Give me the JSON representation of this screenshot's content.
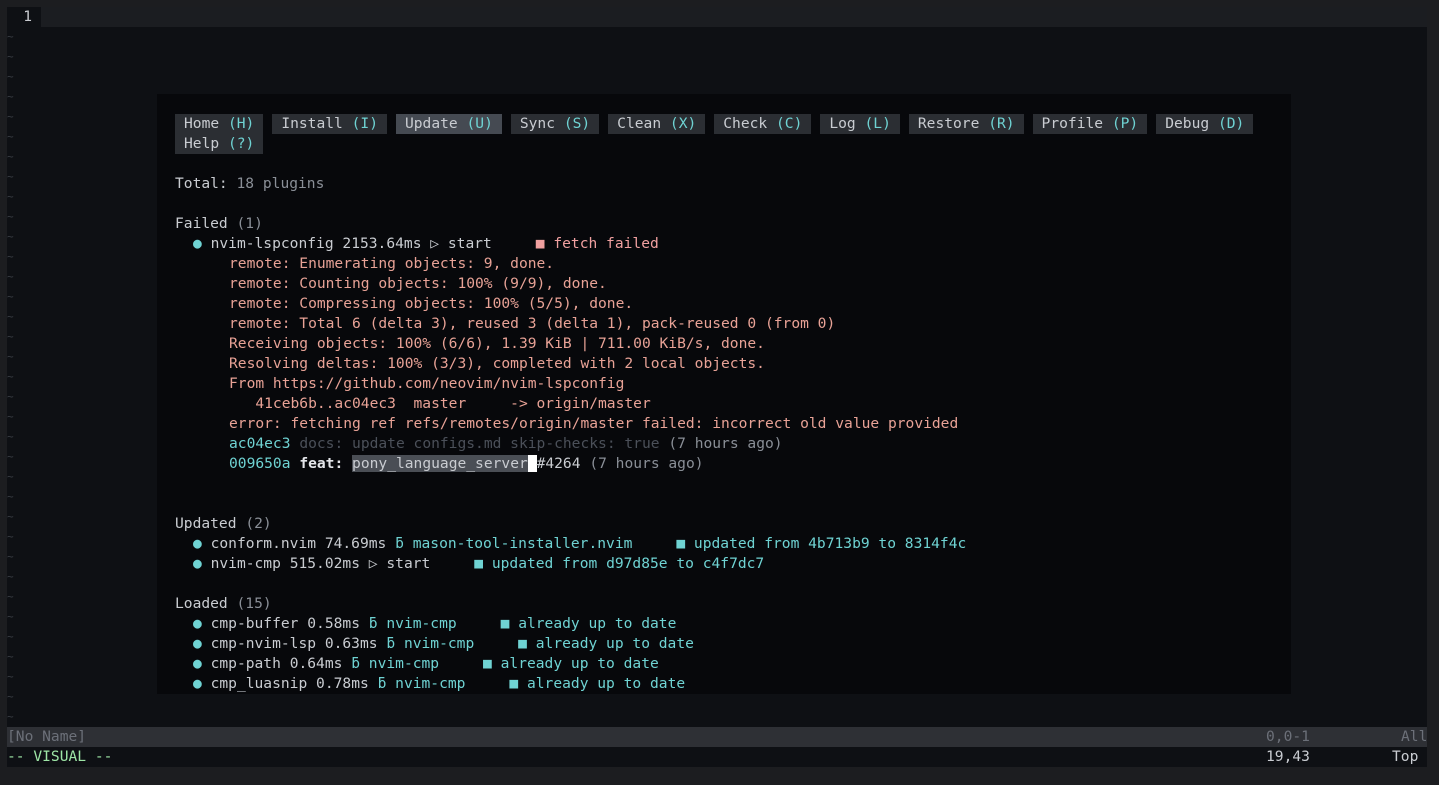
{
  "editor": {
    "line_number": "1",
    "tilde": "~"
  },
  "menu": [
    {
      "label": "Home",
      "key": "(H)"
    },
    {
      "label": "Install",
      "key": "(I)"
    },
    {
      "label": "Update",
      "key": "(U)",
      "active": true
    },
    {
      "label": "Sync",
      "key": "(S)"
    },
    {
      "label": "Clean",
      "key": "(X)"
    },
    {
      "label": "Check",
      "key": "(C)"
    },
    {
      "label": "Log",
      "key": "(L)"
    },
    {
      "label": "Restore",
      "key": "(R)"
    },
    {
      "label": "Profile",
      "key": "(P)"
    },
    {
      "label": "Debug",
      "key": "(D)"
    },
    {
      "label": "Help",
      "key": "(?)"
    }
  ],
  "total": {
    "label": "Total:",
    "value": "18 plugins"
  },
  "failed": {
    "title": "Failed",
    "count": "(1)",
    "plugin": {
      "bullet": "●",
      "name": "nvim-lspconfig",
      "time": "2153.64ms",
      "source_icon": "▷",
      "source": "start",
      "status_icon": "■",
      "status": "fetch failed"
    },
    "log": [
      "remote: Enumerating objects: 9, done.",
      "remote: Counting objects: 100% (9/9), done.",
      "remote: Compressing objects: 100% (5/5), done.",
      "remote: Total 6 (delta 3), reused 3 (delta 1), pack-reused 0 (from 0)",
      "Receiving objects: 100% (6/6), 1.39 KiB | 711.00 KiB/s, done.",
      "Resolving deltas: 100% (3/3), completed with 2 local objects.",
      "From https://github.com/neovim/nvim-lspconfig",
      "   41ceb6b..ac04ec3  master     -> origin/master",
      "error: fetching ref refs/remotes/origin/master failed: incorrect old value provided"
    ],
    "commits": [
      {
        "hash": "ac04ec3",
        "msg": "docs: update configs.md skip-checks: true",
        "age": "(7 hours ago)"
      },
      {
        "hash": "009650a",
        "type": "feat:",
        "selected": "pony_language_server",
        "cursor": " ",
        "rest": "#4264",
        "age": "(7 hours ago)"
      }
    ]
  },
  "updated": {
    "title": "Updated",
    "count": "(2)",
    "items": [
      {
        "name": "conform.nvim",
        "time": "74.69ms",
        "source_icon": "ƃ",
        "source": "mason-tool-installer.nvim",
        "status": "updated from 4b713b9 to 8314f4c",
        "gap": "     "
      },
      {
        "name": "nvim-cmp",
        "time": "515.02ms",
        "source_icon": "▷",
        "source": "start",
        "status": "updated from d97d85e to c4f7dc7",
        "gap": "     ",
        "plain": true
      }
    ]
  },
  "loaded": {
    "title": "Loaded",
    "count": "(15)",
    "items": [
      {
        "name": "cmp-buffer",
        "time": "0.58ms",
        "source_icon": "ƃ",
        "source": "nvim-cmp",
        "status": "already up to date"
      },
      {
        "name": "cmp-nvim-lsp",
        "time": "0.63ms",
        "source_icon": "ƃ",
        "source": "nvim-cmp",
        "status": "already up to date"
      },
      {
        "name": "cmp-path",
        "time": "0.64ms",
        "source_icon": "ƃ",
        "source": "nvim-cmp",
        "status": "already up to date"
      },
      {
        "name": "cmp_luasnip",
        "time": "0.78ms",
        "source_icon": "ƃ",
        "source": "nvim-cmp",
        "status": "already up to date"
      }
    ]
  },
  "statusline": {
    "file": "[No Name]",
    "position": "0,0-1",
    "scroll": "All"
  },
  "cmdline": {
    "mode": "-- VISUAL --",
    "position": "19,43",
    "scroll": "Top"
  },
  "colors": {
    "accent": "#6fd3d3",
    "error": "#e8a296",
    "bg": "#07080b"
  }
}
